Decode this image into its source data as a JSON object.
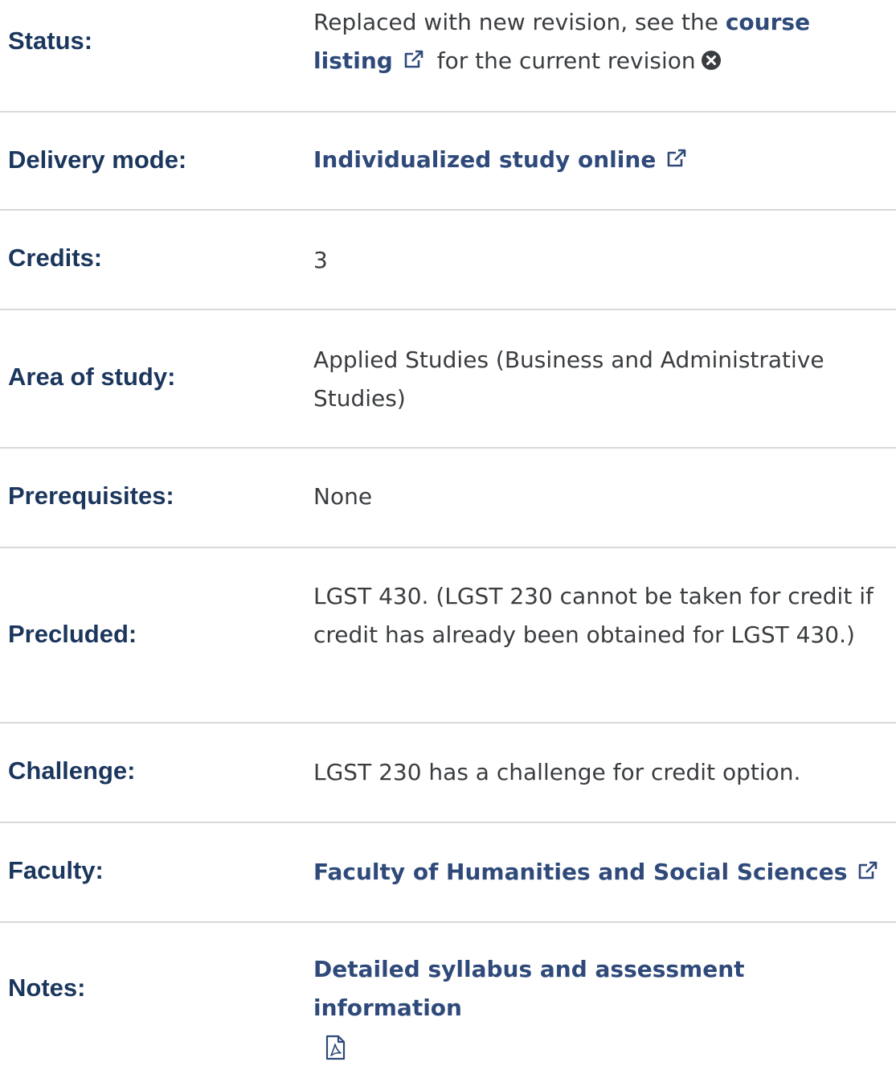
{
  "rows": {
    "status": {
      "label": "Status:",
      "text_before": "Replaced with new revision, see the ",
      "link": "course listing",
      "text_after": "for the current revision"
    },
    "delivery": {
      "label": "Delivery mode:",
      "link": "Individualized study online"
    },
    "credits": {
      "label": "Credits:",
      "value": "3"
    },
    "area": {
      "label": "Area of study:",
      "value": "Applied Studies (Business and Administrative Studies)"
    },
    "prerequisites": {
      "label": "Prerequisites:",
      "value": "None"
    },
    "precluded": {
      "label": "Precluded:",
      "value": "LGST 430. (LGST 230 cannot be taken for credit if credit has already been obtained for LGST 430.)"
    },
    "challenge": {
      "label": "Challenge:",
      "value": "LGST 230 has a challenge for credit option."
    },
    "faculty": {
      "label": "Faculty:",
      "link": "Faculty of Humanities and Social Sciences"
    },
    "notes": {
      "label": "Notes:",
      "link": "Detailed syllabus and assessment information"
    }
  },
  "icons": {
    "external_link": "external-link-icon",
    "close": "close-circle-icon",
    "pdf": "pdf-file-icon"
  },
  "colors": {
    "label": "#1b365d",
    "link": "#2f4a7a",
    "text": "#3a3d40",
    "divider": "#d9d9d9"
  }
}
